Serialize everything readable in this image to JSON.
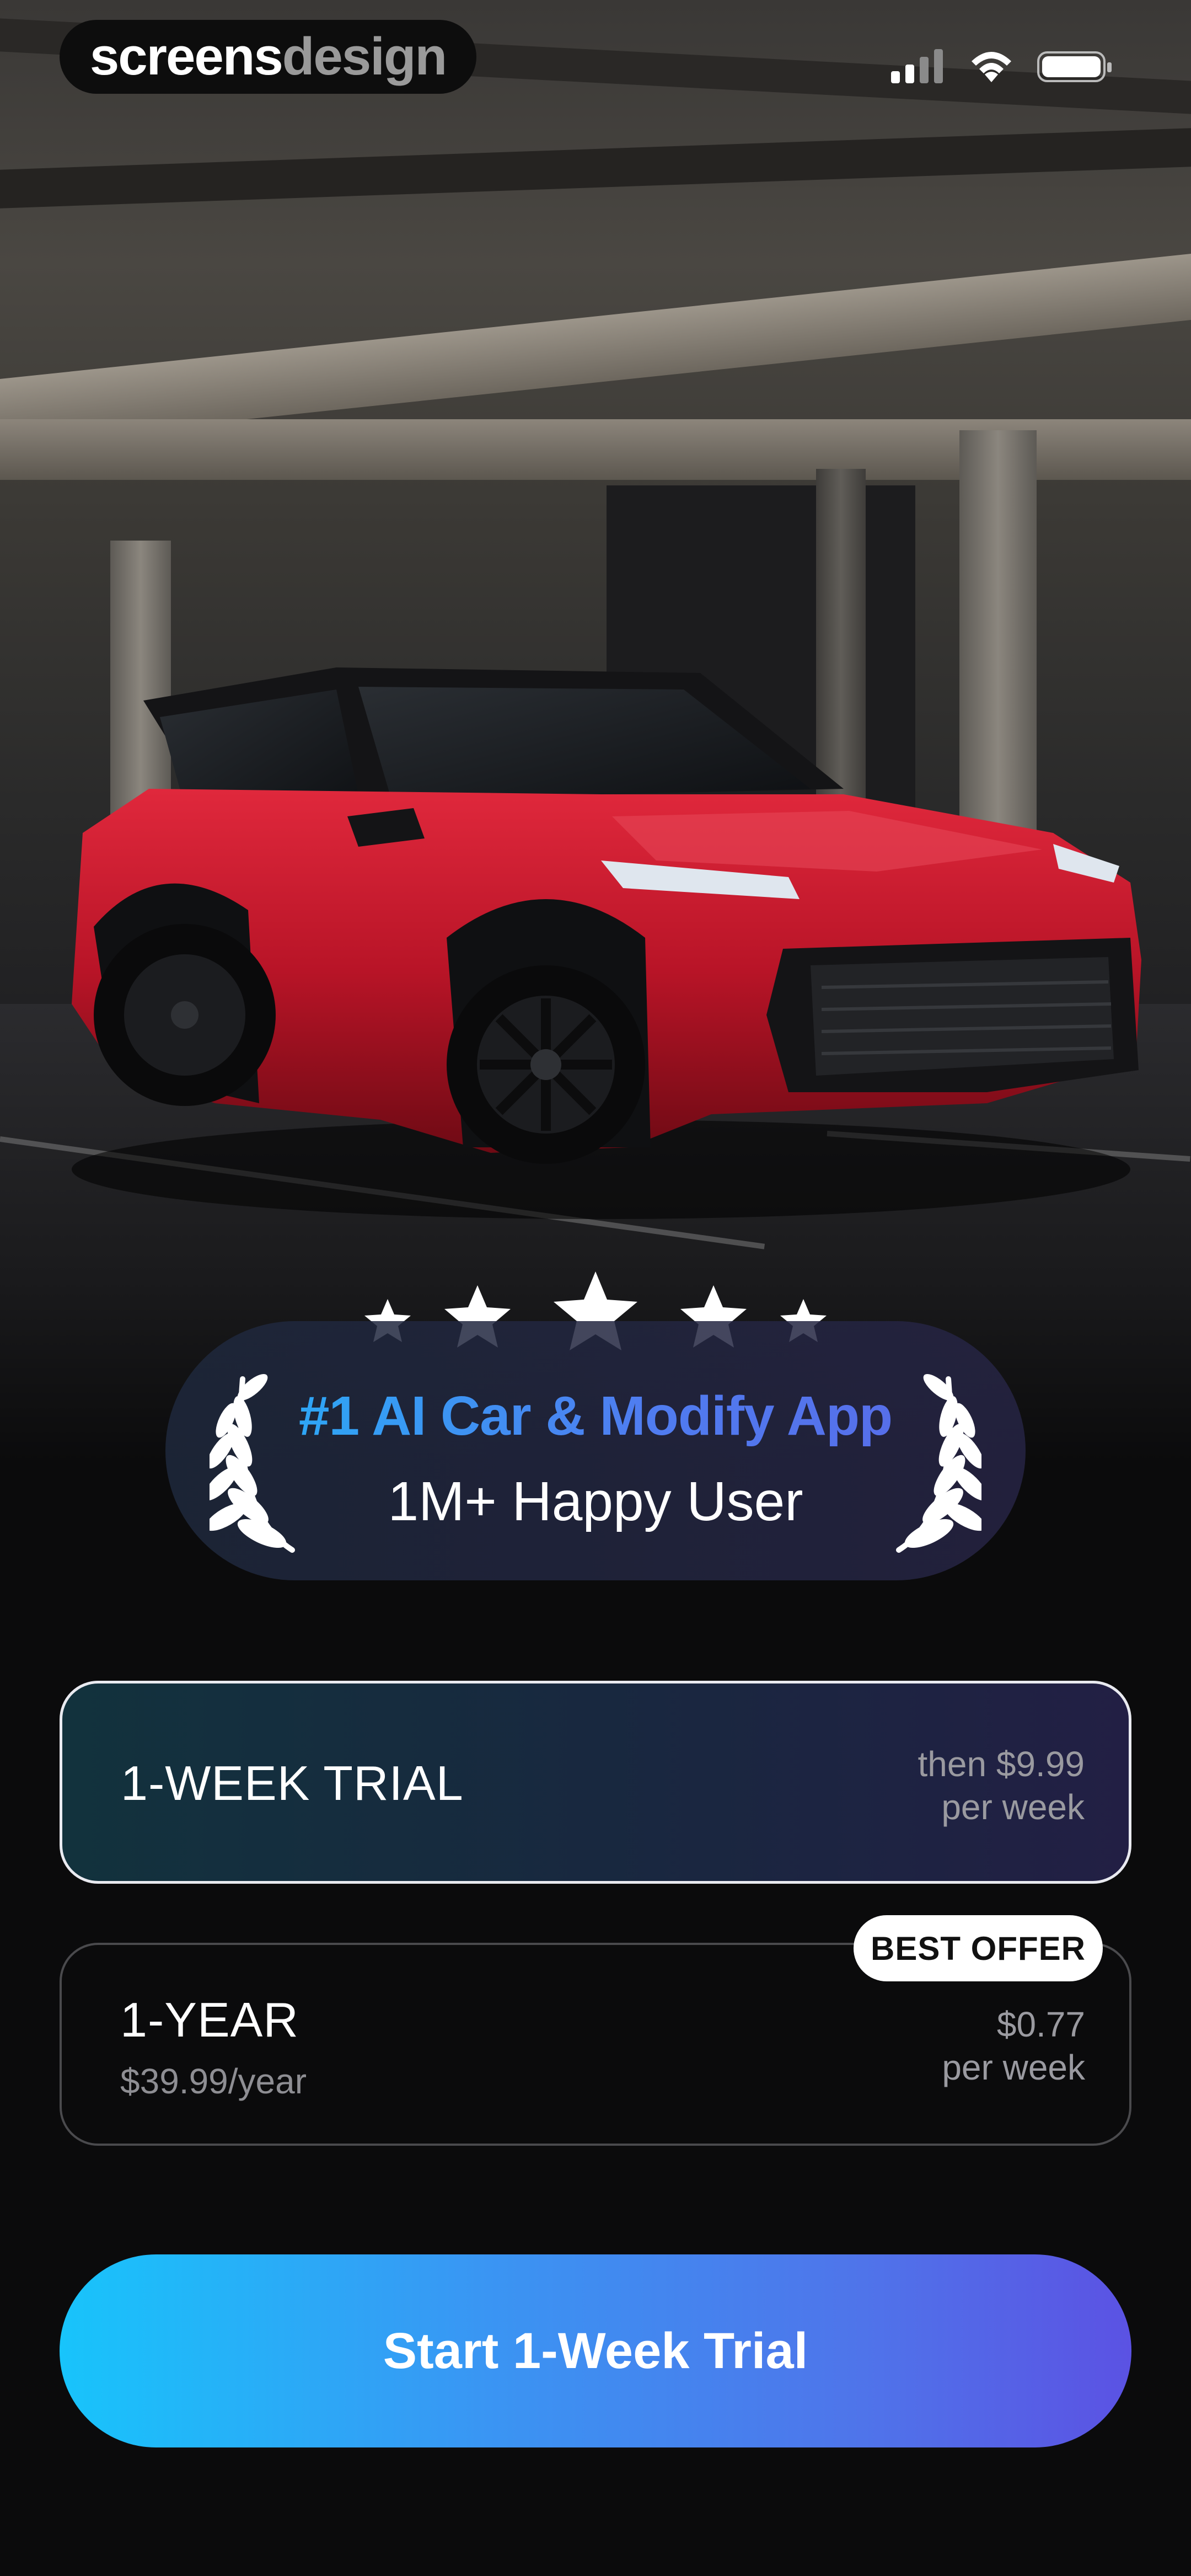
{
  "status_bar": {
    "brand_part1": "screens",
    "brand_part2": "design",
    "icons": [
      "cellular-signal-icon",
      "wifi-icon",
      "battery-icon"
    ]
  },
  "hero": {
    "image": "red-suv-in-parking-garage"
  },
  "rating": {
    "stars": 5,
    "title": "#1 AI Car & Modify App",
    "subtitle": "1M+ Happy User"
  },
  "plans": [
    {
      "name": "1-WEEK TRIAL",
      "price_line1": "then $9.99",
      "price_line2": "per week",
      "selected": true
    },
    {
      "name": "1-YEAR",
      "sub": "$39.99/year",
      "price_line1": "$0.77",
      "price_line2": "per week",
      "badge": "BEST OFFER",
      "selected": false
    }
  ],
  "cta": {
    "label": "Start 1-Week Trial"
  },
  "colors": {
    "background": "#0b0b0c",
    "accent_start": "#18c4fb",
    "accent_end": "#5b52e3",
    "car_red": "#c0162a"
  }
}
